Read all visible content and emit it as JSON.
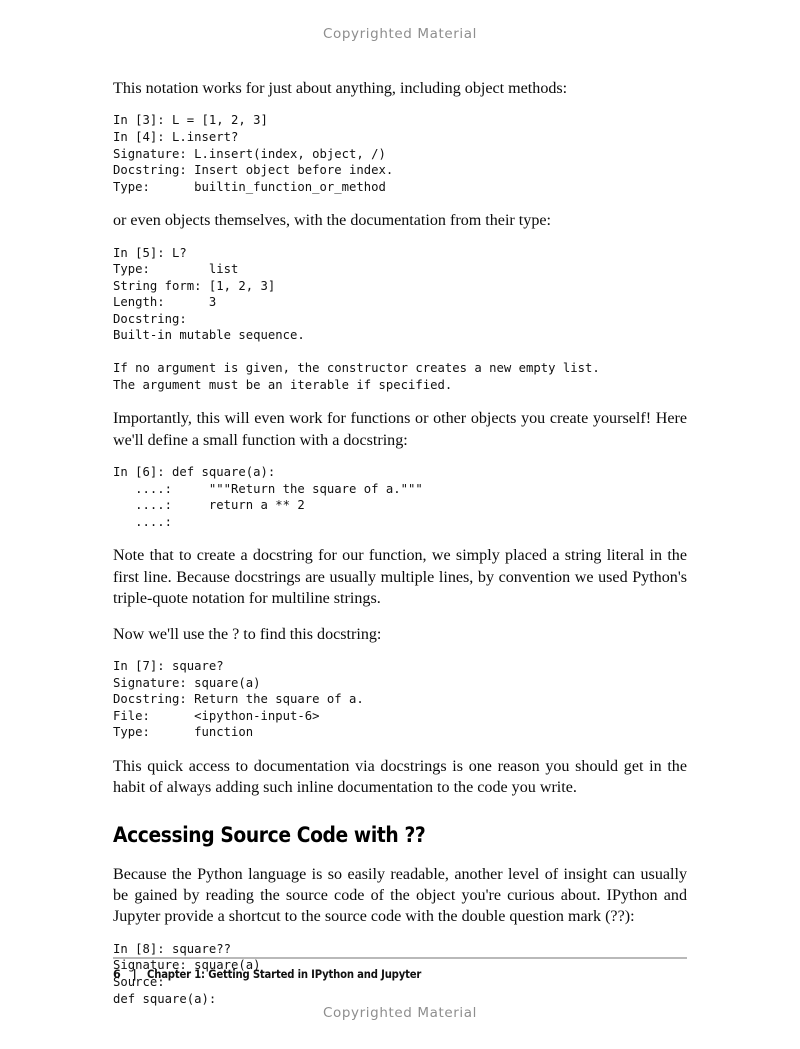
{
  "watermark": {
    "top": "Copyrighted Material",
    "bottom": "Copyrighted Material"
  },
  "content": {
    "para_1": "This notation works for just about anything, including object methods:",
    "code_1": "In [3]: L = [1, 2, 3]\nIn [4]: L.insert?\nSignature: L.insert(index, object, /)\nDocstring: Insert object before index.\nType:      builtin_function_or_method",
    "para_2": "or even objects themselves, with the documentation from their type:",
    "code_2": "In [5]: L?\nType:        list\nString form: [1, 2, 3]\nLength:      3\nDocstring:\nBuilt-in mutable sequence.\n\nIf no argument is given, the constructor creates a new empty list.\nThe argument must be an iterable if specified.",
    "para_3": "Importantly, this will even work for functions or other objects you create yourself! Here we'll define a small function with a docstring:",
    "code_3": "In [6]: def square(a):\n   ....:     \"\"\"Return the square of a.\"\"\"\n   ....:     return a ** 2\n   ....:",
    "para_4": "Note that to create a docstring for our function, we simply placed a string literal in the first line. Because docstrings are usually multiple lines, by convention we used Python's triple-quote notation for multiline strings.",
    "para_5": "Now we'll use the ? to find this docstring:",
    "code_4": "In [7]: square?\nSignature: square(a)\nDocstring: Return the square of a.\nFile:      <ipython-input-6>\nType:      function",
    "para_6": "This quick access to documentation via docstrings is one reason you should get in the habit of always adding such inline documentation to the code you write.",
    "heading_1": "Accessing Source Code with ??",
    "para_7": "Because the Python language is so easily readable, another level of insight can usually be gained by reading the source code of the object you're curious about. IPython and Jupyter provide a shortcut to the source code with the double question mark (??):",
    "code_5": "In [8]: square??\nSignature: square(a)\nSource:\ndef square(a):"
  },
  "footer": {
    "page_number": "6",
    "separator": "|",
    "chapter": "Chapter 1: Getting Started in IPython and Jupyter"
  },
  "colors": {
    "text": "#0b0b0b",
    "watermark": "#8e8e8e",
    "rule": "#b9b9b9",
    "page_background": "#ffffff"
  }
}
